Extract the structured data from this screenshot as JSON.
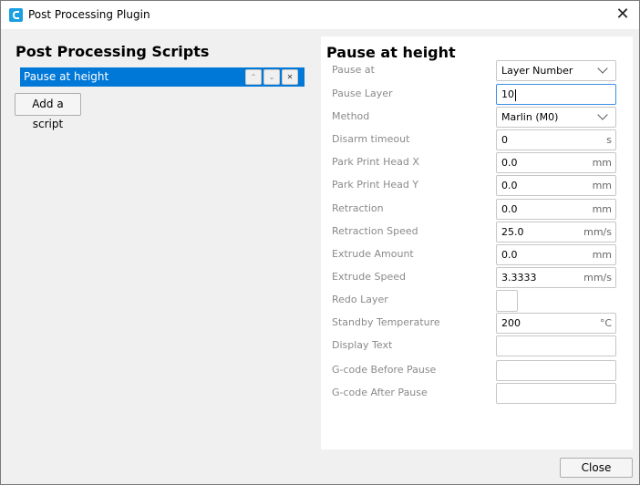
{
  "window": {
    "title": "Post Processing Plugin",
    "app_icon": "cura-icon",
    "close_icon": "✕"
  },
  "left": {
    "heading": "Post Processing Scripts",
    "scripts": [
      {
        "label": "Pause at height",
        "selected": true
      }
    ],
    "move_up_glyph": "⌃",
    "move_down_glyph": "⌄",
    "remove_glyph": "✕",
    "add_script_label": "Add a script"
  },
  "right": {
    "heading": "Pause at height",
    "settings": [
      {
        "label": "Pause at",
        "type": "dropdown",
        "value": "Layer Number",
        "unit": ""
      },
      {
        "label": "Pause Layer",
        "type": "text",
        "value": "10",
        "unit": "",
        "focused": true
      },
      {
        "label": "Method",
        "type": "dropdown",
        "value": "Marlin (M0)",
        "unit": ""
      },
      {
        "label": "Disarm timeout",
        "type": "text",
        "value": "0",
        "unit": "s"
      },
      {
        "label": "Park Print Head X",
        "type": "text",
        "value": "0.0",
        "unit": "mm"
      },
      {
        "label": "Park Print Head Y",
        "type": "text",
        "value": "0.0",
        "unit": "mm"
      },
      {
        "label": "Retraction",
        "type": "text",
        "value": "0.0",
        "unit": "mm"
      },
      {
        "label": "Retraction Speed",
        "type": "text",
        "value": "25.0",
        "unit": "mm/s"
      },
      {
        "label": "Extrude Amount",
        "type": "text",
        "value": "0.0",
        "unit": "mm"
      },
      {
        "label": "Extrude Speed",
        "type": "text",
        "value": "3.3333",
        "unit": "mm/s"
      },
      {
        "label": "Redo Layer",
        "type": "checkbox",
        "value": "",
        "unit": "",
        "checked": false
      },
      {
        "label": "Standby Temperature",
        "type": "text",
        "value": "200",
        "unit": "°C"
      },
      {
        "label": "Display Text",
        "type": "text",
        "value": "",
        "unit": ""
      },
      {
        "label": "G-code Before Pause",
        "type": "text",
        "value": "",
        "unit": ""
      },
      {
        "label": "G-code After Pause",
        "type": "text",
        "value": "",
        "unit": ""
      }
    ]
  },
  "footer": {
    "close_label": "Close"
  },
  "colors": {
    "accent": "#0078d7",
    "focus_border": "#3a8ee6",
    "label_gray": "#8a8a8a",
    "app_icon": "#1aa0e0"
  }
}
